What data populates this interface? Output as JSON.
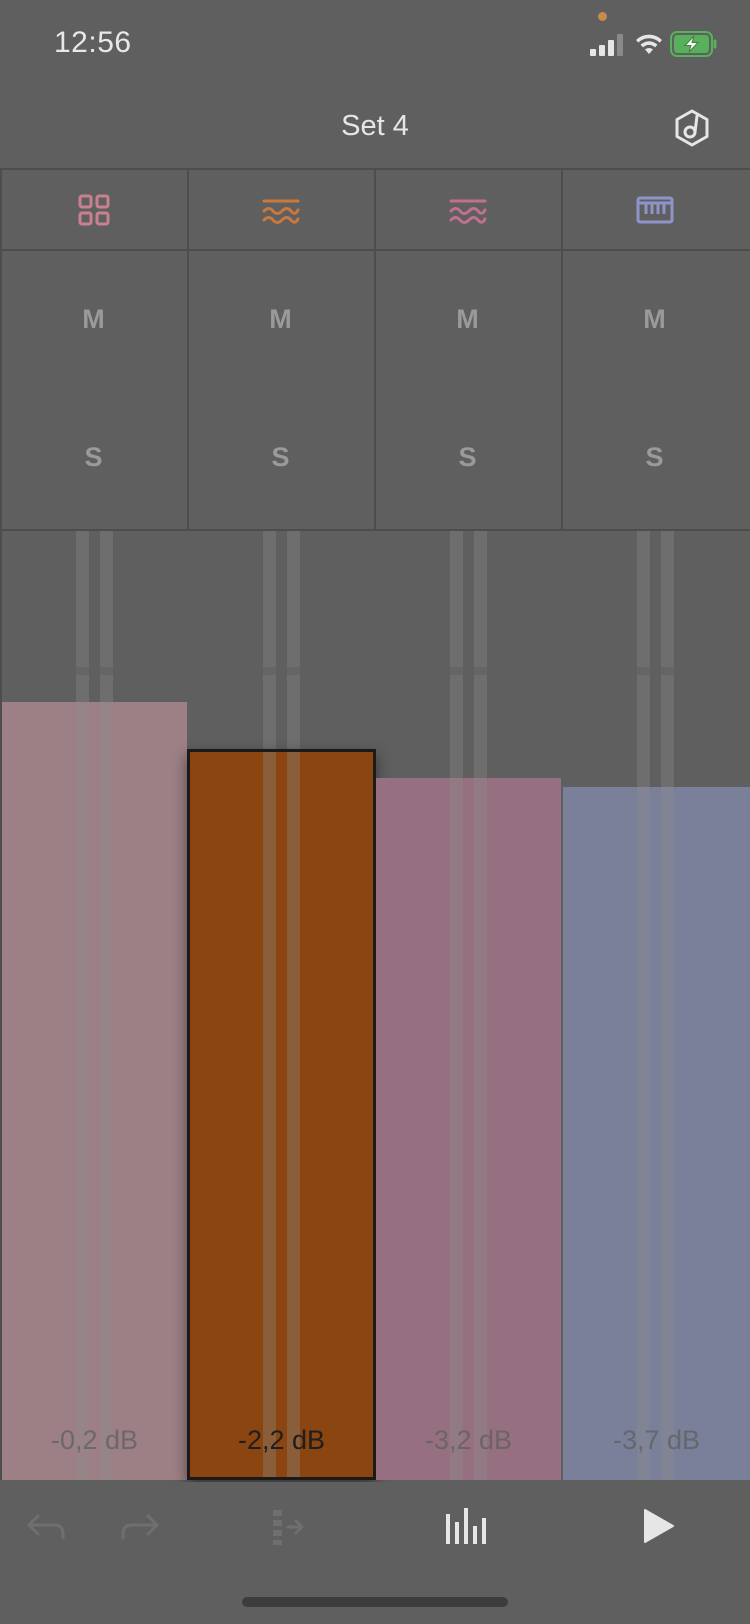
{
  "status_bar": {
    "time": "12:56",
    "icons": [
      "camera-indicator-dot",
      "cellular-signal-icon",
      "wifi-icon",
      "battery-charging-icon"
    ]
  },
  "header": {
    "title": "Set 4",
    "right_icon": "session-settings-icon"
  },
  "tracks": [
    {
      "id": 1,
      "icon": "drum-rack-grid-icon",
      "color": "#c9808f",
      "fader_color": "#9c8086",
      "mute_label": "M",
      "solo_label": "S",
      "level_db": "-0,2 dB",
      "fader_level": 0.82,
      "selected": false
    },
    {
      "id": 2,
      "icon": "wavetable-waves-icon",
      "color": "#c9793d",
      "fader_color": "#8b4510",
      "mute_label": "M",
      "solo_label": "S",
      "level_db": "-2,2 dB",
      "fader_level": 0.77,
      "selected": true
    },
    {
      "id": 3,
      "icon": "waves-icon",
      "color": "#c2708f",
      "fader_color": "#967081",
      "mute_label": "M",
      "solo_label": "S",
      "level_db": "-3,2 dB",
      "fader_level": 0.74,
      "selected": false
    },
    {
      "id": 4,
      "icon": "keyboard-icon",
      "color": "#8f94c8",
      "fader_color": "#7a8099",
      "mute_label": "M",
      "solo_label": "S",
      "level_db": "-3,7 dB",
      "fader_level": 0.73,
      "selected": false
    }
  ],
  "toolbar": {
    "items": [
      "undo-icon",
      "redo-icon",
      "insert-clip-icon",
      "mixer-icon",
      "play-icon"
    ]
  }
}
